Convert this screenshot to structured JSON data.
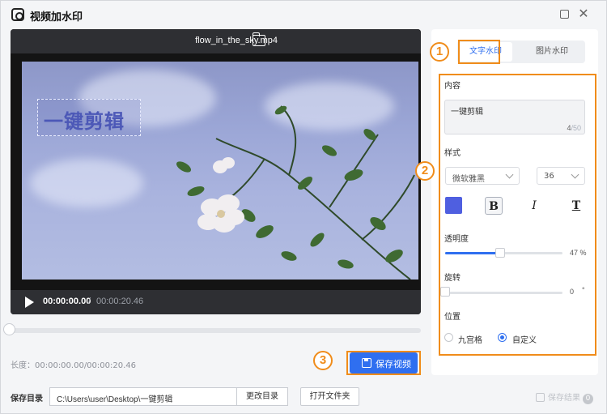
{
  "window": {
    "title": "视频加水印",
    "maximize_icon": "maximize-icon",
    "close_glyph": "✕"
  },
  "player": {
    "filename": "flow_in_the_sky.mp4",
    "watermark_text": "一键剪辑",
    "current_time": "00:00:00.00",
    "separator": "/",
    "total_time": "00:00:20.46",
    "progress": 0
  },
  "timeline": {
    "position": 0
  },
  "length": "长度：00:00:00.00/00:00:20.46",
  "save_video_label": "保存视频",
  "save_dir": {
    "label": "保存目录",
    "path": "C:\\Users\\user\\Desktop\\一键剪辑",
    "change_label": "更改目录",
    "open_label": "打开文件夹"
  },
  "save_done": {
    "label": "保存结果",
    "count": "0"
  },
  "panel": {
    "tabs": [
      {
        "label": "文字水印",
        "active": true
      },
      {
        "label": "图片水印",
        "active": false
      }
    ],
    "content_label": "内容",
    "content_text": "一键剪辑",
    "content_count": "4",
    "content_max": "/50",
    "style_label": "样式",
    "font": "微软雅黑",
    "font_size": "36",
    "color": "#4f5fe0",
    "bold": "B",
    "italic": "I",
    "underline": "T",
    "opacity_label": "透明度",
    "opacity_value": "47 %",
    "opacity": 0.47,
    "rotate_label": "旋转",
    "rotate_value": "0",
    "rotate_unit": "°",
    "rotate": 0,
    "position_label": "位置",
    "position_options": [
      {
        "label": "九宫格",
        "selected": false
      },
      {
        "label": "自定义",
        "selected": true
      }
    ]
  },
  "annotations": [
    "1",
    "2",
    "3"
  ],
  "colors": {
    "accent": "#2f6ff0",
    "annotation": "#f08c1a"
  }
}
